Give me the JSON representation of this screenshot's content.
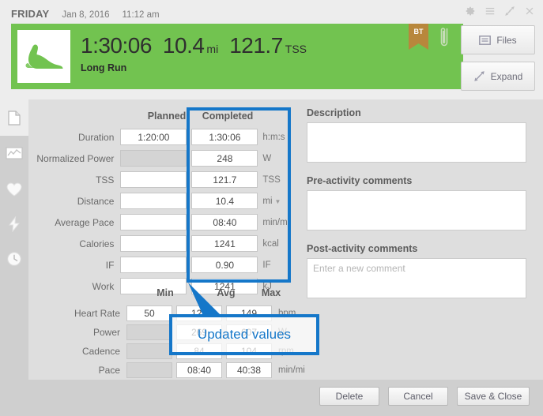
{
  "header": {
    "day_of_week": "FRIDAY",
    "date": "Jan 8, 2016",
    "time": "11:12 am",
    "window_icons": [
      "gear-icon",
      "menu-icon",
      "shrink-icon",
      "close-icon"
    ],
    "green_color": "#72c350",
    "activity_icon": "running-shoe-icon",
    "duration": "1:30:06",
    "distance": "10.4",
    "distance_unit": "mi",
    "tss": "121.7",
    "tss_unit": "TSS",
    "workout_title": "Long Run",
    "ribbon_label": "BT",
    "ribbon_color": "#b8873c",
    "attachment_icon": "paperclip-icon",
    "files_label": "Files",
    "expand_label": "Expand"
  },
  "sidebar": {
    "items": [
      {
        "icon": "page-icon",
        "active": true
      },
      {
        "icon": "chart-icon",
        "active": false
      },
      {
        "icon": "heart-icon",
        "active": false
      },
      {
        "icon": "lightning-icon",
        "active": false
      },
      {
        "icon": "clock-icon",
        "active": false
      }
    ]
  },
  "form": {
    "col_planned": "Planned",
    "col_completed": "Completed",
    "rows": [
      {
        "label": "Duration",
        "planned": "1:20:00",
        "planned_disabled": false,
        "completed": "1:30:06",
        "unit": "h:m:s",
        "unit_dropdown": false
      },
      {
        "label": "Normalized Power",
        "planned": "",
        "planned_disabled": true,
        "completed": "248",
        "unit": "W",
        "unit_dropdown": false
      },
      {
        "label": "TSS",
        "planned": "",
        "planned_disabled": false,
        "completed": "121.7",
        "unit": "TSS",
        "unit_dropdown": false
      },
      {
        "label": "Distance",
        "planned": "",
        "planned_disabled": false,
        "completed": "10.4",
        "unit": "mi",
        "unit_dropdown": true
      },
      {
        "label": "Average Pace",
        "planned": "",
        "planned_disabled": false,
        "completed": "08:40",
        "unit": "min/mi",
        "unit_dropdown": false
      },
      {
        "label": "Calories",
        "planned": "",
        "planned_disabled": false,
        "completed": "1241",
        "unit": "kcal",
        "unit_dropdown": false
      },
      {
        "label": "IF",
        "planned": "",
        "planned_disabled": false,
        "completed": "0.90",
        "unit": "IF",
        "unit_dropdown": false
      },
      {
        "label": "Work",
        "planned": "",
        "planned_disabled": false,
        "completed": "1241",
        "unit": "kJ",
        "unit_dropdown": false
      }
    ],
    "col_min": "Min",
    "col_avg": "Avg",
    "col_max": "Max",
    "stats_rows": [
      {
        "label": "Heart Rate",
        "min": "50",
        "min_disabled": false,
        "avg": "123",
        "max": "149",
        "unit": "bpm"
      },
      {
        "label": "Power",
        "min": "",
        "min_disabled": true,
        "avg": "269",
        "max": "607",
        "unit": "W"
      },
      {
        "label": "Cadence",
        "min": "",
        "min_disabled": true,
        "avg": "84",
        "max": "104",
        "unit": "rpm"
      },
      {
        "label": "Pace",
        "min": "",
        "min_disabled": true,
        "avg": "08:40",
        "max": "40:38",
        "unit": "min/mi"
      }
    ]
  },
  "notes": {
    "description_label": "Description",
    "description_value": "",
    "description_placeholder": "",
    "pre_label": "Pre-activity comments",
    "pre_value": "",
    "pre_placeholder": "",
    "post_label": "Post-activity comments",
    "post_value": "",
    "post_placeholder": "Enter a new comment"
  },
  "footer": {
    "delete_label": "Delete",
    "cancel_label": "Cancel",
    "save_close_label": "Save & Close"
  },
  "annotations": {
    "highlight_color": "#1577c9",
    "callout_text": "Updated values"
  }
}
